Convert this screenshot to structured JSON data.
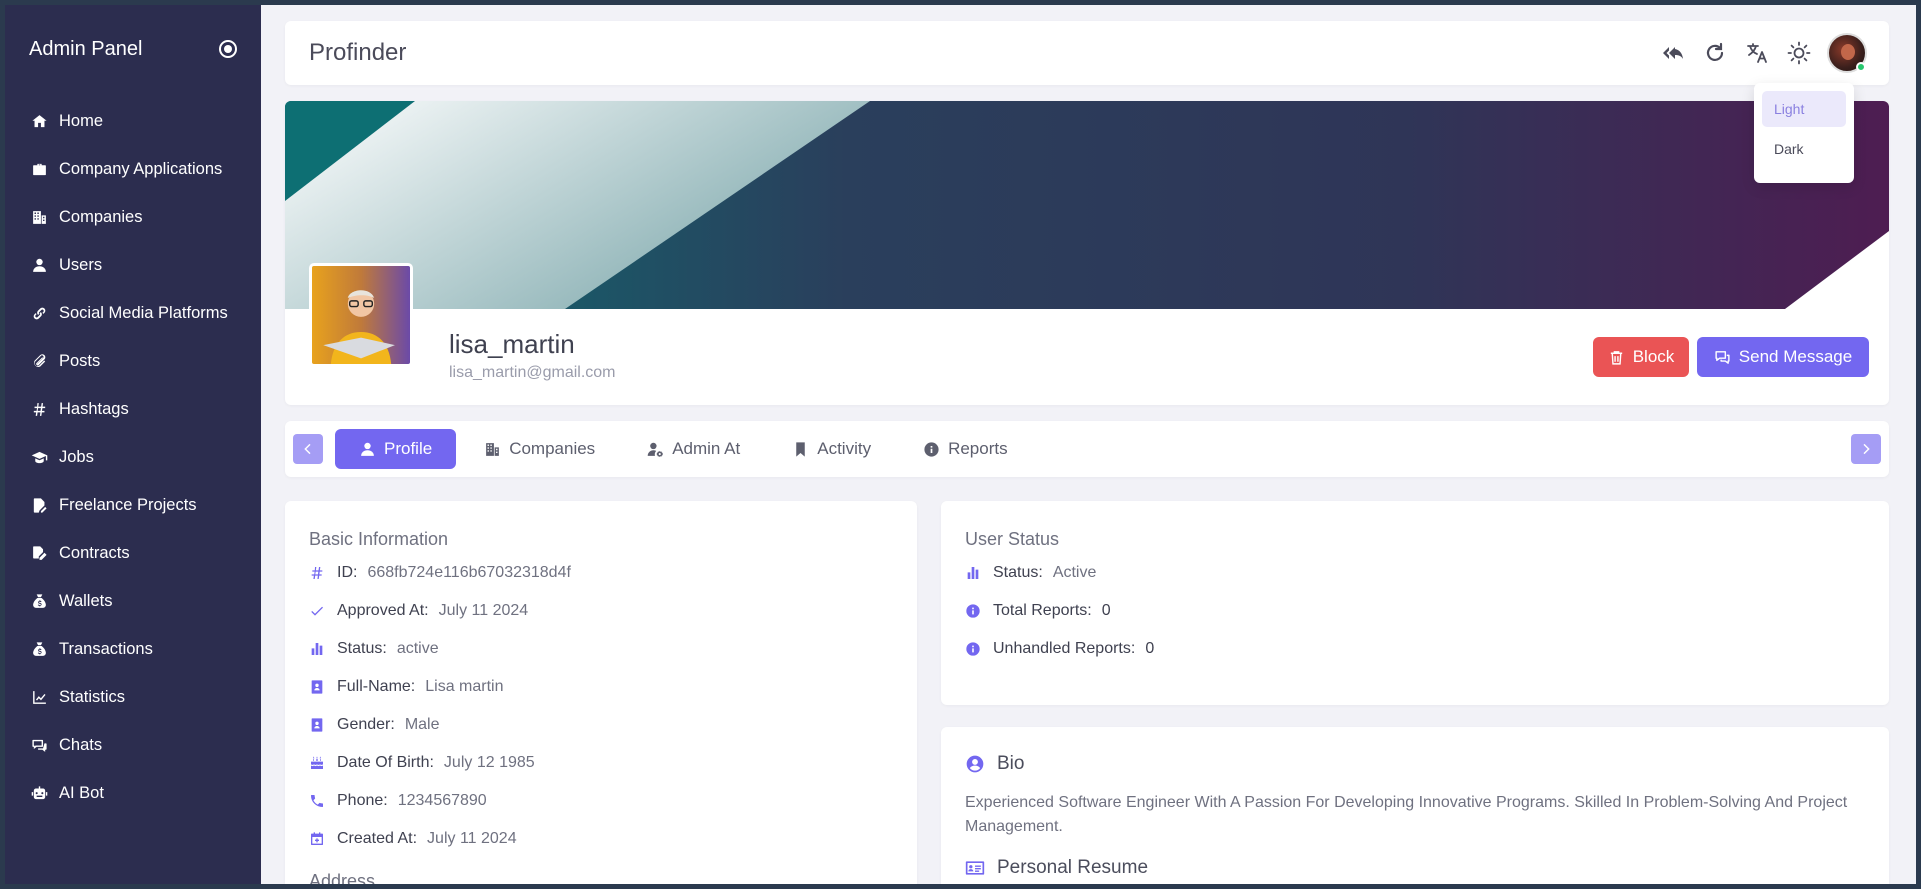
{
  "sidebar": {
    "title": "Admin Panel",
    "items": [
      {
        "label": "Home",
        "icon": "home-icon"
      },
      {
        "label": "Company Applications",
        "icon": "briefcase-icon"
      },
      {
        "label": "Companies",
        "icon": "building-icon"
      },
      {
        "label": "Users",
        "icon": "user-icon"
      },
      {
        "label": "Social Media Platforms",
        "icon": "link-icon"
      },
      {
        "label": "Posts",
        "icon": "paperclip-icon"
      },
      {
        "label": "Hashtags",
        "icon": "hashtag-icon"
      },
      {
        "label": "Jobs",
        "icon": "graduation-cap-icon"
      },
      {
        "label": "Freelance Projects",
        "icon": "file-pen-icon"
      },
      {
        "label": "Contracts",
        "icon": "file-signature-icon"
      },
      {
        "label": "Wallets",
        "icon": "money-bag-icon"
      },
      {
        "label": "Transactions",
        "icon": "money-bag-icon"
      },
      {
        "label": "Statistics",
        "icon": "line-chart-icon"
      },
      {
        "label": "Chats",
        "icon": "chat-icon"
      },
      {
        "label": "AI Bot",
        "icon": "robot-icon"
      }
    ]
  },
  "header": {
    "title": "Profinder",
    "theme_menu": {
      "options": [
        "Light",
        "Dark"
      ],
      "selected": "Light"
    }
  },
  "profile": {
    "username": "lisa_martin",
    "email": "lisa_martin@gmail.com",
    "block_label": "Block",
    "message_label": "Send Message"
  },
  "tabs": [
    {
      "label": "Profile",
      "active": true
    },
    {
      "label": "Companies",
      "active": false
    },
    {
      "label": "Admin At",
      "active": false
    },
    {
      "label": "Activity",
      "active": false
    },
    {
      "label": "Reports",
      "active": false
    }
  ],
  "basic_info": {
    "title": "Basic Information",
    "rows": [
      {
        "label": "ID:",
        "value": "668fb724e116b67032318d4f",
        "icon": "hashtag-icon"
      },
      {
        "label": "Approved At:",
        "value": "July 11 2024",
        "icon": "check-icon"
      },
      {
        "label": "Status:",
        "value": "active",
        "icon": "bar-chart-icon"
      },
      {
        "label": "Full-Name:",
        "value": "Lisa martin",
        "icon": "id-badge-icon"
      },
      {
        "label": "Gender:",
        "value": "Male",
        "icon": "id-badge-icon"
      },
      {
        "label": "Date Of Birth:",
        "value": "July 12 1985",
        "icon": "cake-icon"
      },
      {
        "label": "Phone:",
        "value": "1234567890",
        "icon": "phone-icon"
      },
      {
        "label": "Created At:",
        "value": "July 11 2024",
        "icon": "calendar-icon"
      }
    ],
    "next_section": "Address"
  },
  "user_status": {
    "title": "User Status",
    "rows": [
      {
        "label": "Status:",
        "value": "Active",
        "icon": "bar-chart-icon"
      },
      {
        "label": "Total Reports:",
        "value": "0",
        "icon": "info-icon"
      },
      {
        "label": "Unhandled Reports:",
        "value": "0",
        "icon": "info-icon"
      }
    ]
  },
  "bio": {
    "title": "Bio",
    "text": "Experienced Software Engineer With A Passion For Developing Innovative Programs. Skilled In Problem-Solving And Project Management.",
    "resume_title": "Personal Resume"
  },
  "colors": {
    "sidebar_bg": "#2c2d4f",
    "primary": "#7367f0",
    "danger": "#ea5455",
    "page_bg": "#f2f2f7"
  }
}
